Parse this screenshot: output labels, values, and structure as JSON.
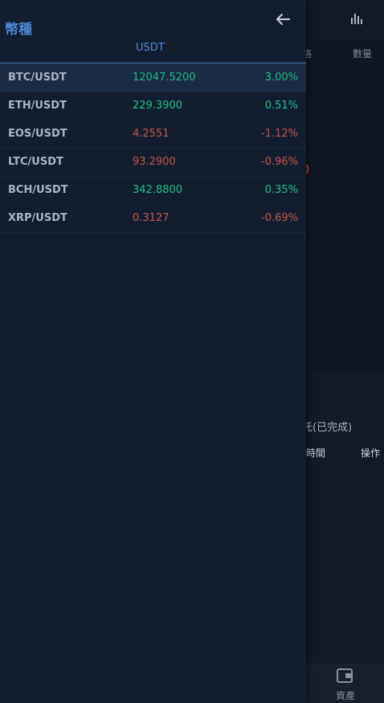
{
  "background": {
    "header_col_price_fragment": "格",
    "header_col_quantity": "數量",
    "big_value_fragment": "0",
    "orders_title_fragment": "託(已完成)",
    "col_time": "時間",
    "col_operation": "操作",
    "bottom_nav_assets_label": "資產",
    "icons": [
      "bar-chart-icon",
      "wallet-icon"
    ]
  },
  "drawer": {
    "title": "幣種",
    "back_icon": "arrow-left-icon",
    "tabs": [
      {
        "label": "USDT",
        "active": true
      }
    ],
    "colors": {
      "up": "#1fbf86",
      "down": "#c8514b",
      "accent": "#4d86d6"
    },
    "pairs": [
      {
        "symbol": "BTC/USDT",
        "price": "12047.5200",
        "change": "3.00%",
        "direction": "up",
        "selected": true
      },
      {
        "symbol": "ETH/USDT",
        "price": "229.3900",
        "change": "0.51%",
        "direction": "up",
        "selected": false
      },
      {
        "symbol": "EOS/USDT",
        "price": "4.2551",
        "change": "-1.12%",
        "direction": "down",
        "selected": false
      },
      {
        "symbol": "LTC/USDT",
        "price": "93.2900",
        "change": "-0.96%",
        "direction": "down",
        "selected": false
      },
      {
        "symbol": "BCH/USDT",
        "price": "342.8800",
        "change": "0.35%",
        "direction": "up",
        "selected": false
      },
      {
        "symbol": "XRP/USDT",
        "price": "0.3127",
        "change": "-0.69%",
        "direction": "down",
        "selected": false
      }
    ]
  }
}
